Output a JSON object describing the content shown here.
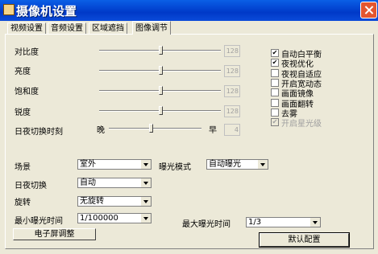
{
  "window": {
    "title": "摄像机设置"
  },
  "tabs": [
    {
      "label": "视频设置"
    },
    {
      "label": "音频设置"
    },
    {
      "label": "区域遮挡"
    },
    {
      "label": "图像调节"
    }
  ],
  "sliders": [
    {
      "label": "对比度",
      "value": "128",
      "level": 0.5
    },
    {
      "label": "亮度",
      "value": "128",
      "level": 0.5
    },
    {
      "label": "饱和度",
      "value": "128",
      "level": 0.5
    },
    {
      "label": "锐度",
      "value": "128",
      "level": 0.5
    }
  ],
  "day_night": {
    "label": "日夜切换时刻",
    "left": "晚",
    "right": "早",
    "value": "4",
    "level": 0.45
  },
  "checkboxes": [
    {
      "label": "自动白平衡",
      "checked": true,
      "disabled": false
    },
    {
      "label": "夜视优化",
      "checked": true,
      "disabled": false
    },
    {
      "label": "夜视自适应",
      "checked": false,
      "disabled": false
    },
    {
      "label": "开启宽动态",
      "checked": false,
      "disabled": false
    },
    {
      "label": "画面镜像",
      "checked": false,
      "disabled": false
    },
    {
      "label": "画面翻转",
      "checked": false,
      "disabled": false
    },
    {
      "label": "去雾",
      "checked": false,
      "disabled": false
    },
    {
      "label": "开启星光级",
      "checked": true,
      "disabled": true
    }
  ],
  "check_mark": "✔",
  "scene": {
    "label": "场景",
    "value": "室外"
  },
  "exposure_mode": {
    "label": "曝光模式",
    "value": "自动曝光"
  },
  "day_night_switch": {
    "label": "日夜切换",
    "value": "自动"
  },
  "rotation": {
    "label": "旋转",
    "value": "无旋转"
  },
  "min_exposure": {
    "label": "最小曝光时间",
    "value": "1/100000"
  },
  "max_exposure": {
    "label": "最大曝光时间",
    "value": "1/3"
  },
  "buttons": {
    "electronic_screen": "电子屏调整",
    "default": "默认配置"
  }
}
